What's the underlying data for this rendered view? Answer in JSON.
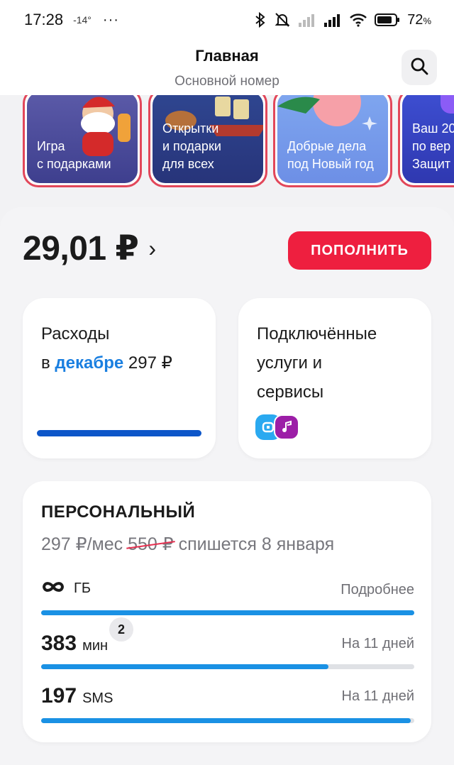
{
  "status_bar": {
    "time": "17:28",
    "temperature": "-14°",
    "more": "···",
    "battery_percent": "72",
    "battery_unit": "%"
  },
  "header": {
    "title": "Главная",
    "subtitle": "Основной номер"
  },
  "stories": [
    {
      "line1": "Игра",
      "line2": "с подарками"
    },
    {
      "line1": "Открытки",
      "line2": "и подарки",
      "line3": "для всех"
    },
    {
      "line1": "Добрые дела",
      "line2": "под Новый год"
    },
    {
      "line1": "Ваш 20",
      "line2": "по вер",
      "line3": "Защит"
    }
  ],
  "balance": {
    "amount": "29,01 ₽",
    "chevron": "›",
    "topup_label": "ПОПОЛНИТЬ"
  },
  "expenses": {
    "line1": "Расходы",
    "prefix": "в",
    "month_link": "декабре",
    "amount": "297 ₽",
    "fill": 1.0,
    "bar_color": "#0d56c9"
  },
  "services": {
    "line1": "Подключённые",
    "line2": "услуги и",
    "line3": "сервисы"
  },
  "tariff": {
    "name": "ПЕРСОНАЛЬНЫЙ",
    "price": "297 ₽/мес",
    "old_price": "550 ₽",
    "charge_text": "спишется 8 января",
    "rows": [
      {
        "value": "",
        "unit": "ГБ",
        "right": "Подробнее",
        "fill": 1.0
      },
      {
        "value": "383",
        "unit": "мин",
        "right": "На 11 дней",
        "fill": 0.77,
        "badge": "2"
      },
      {
        "value": "197",
        "unit": "SMS",
        "right": "На 11 дней",
        "fill": 0.99
      }
    ]
  },
  "colors": {
    "accent_red": "#ee1f3f",
    "link_blue": "#1a7fe0",
    "bar_blue": "#1a91e4"
  }
}
